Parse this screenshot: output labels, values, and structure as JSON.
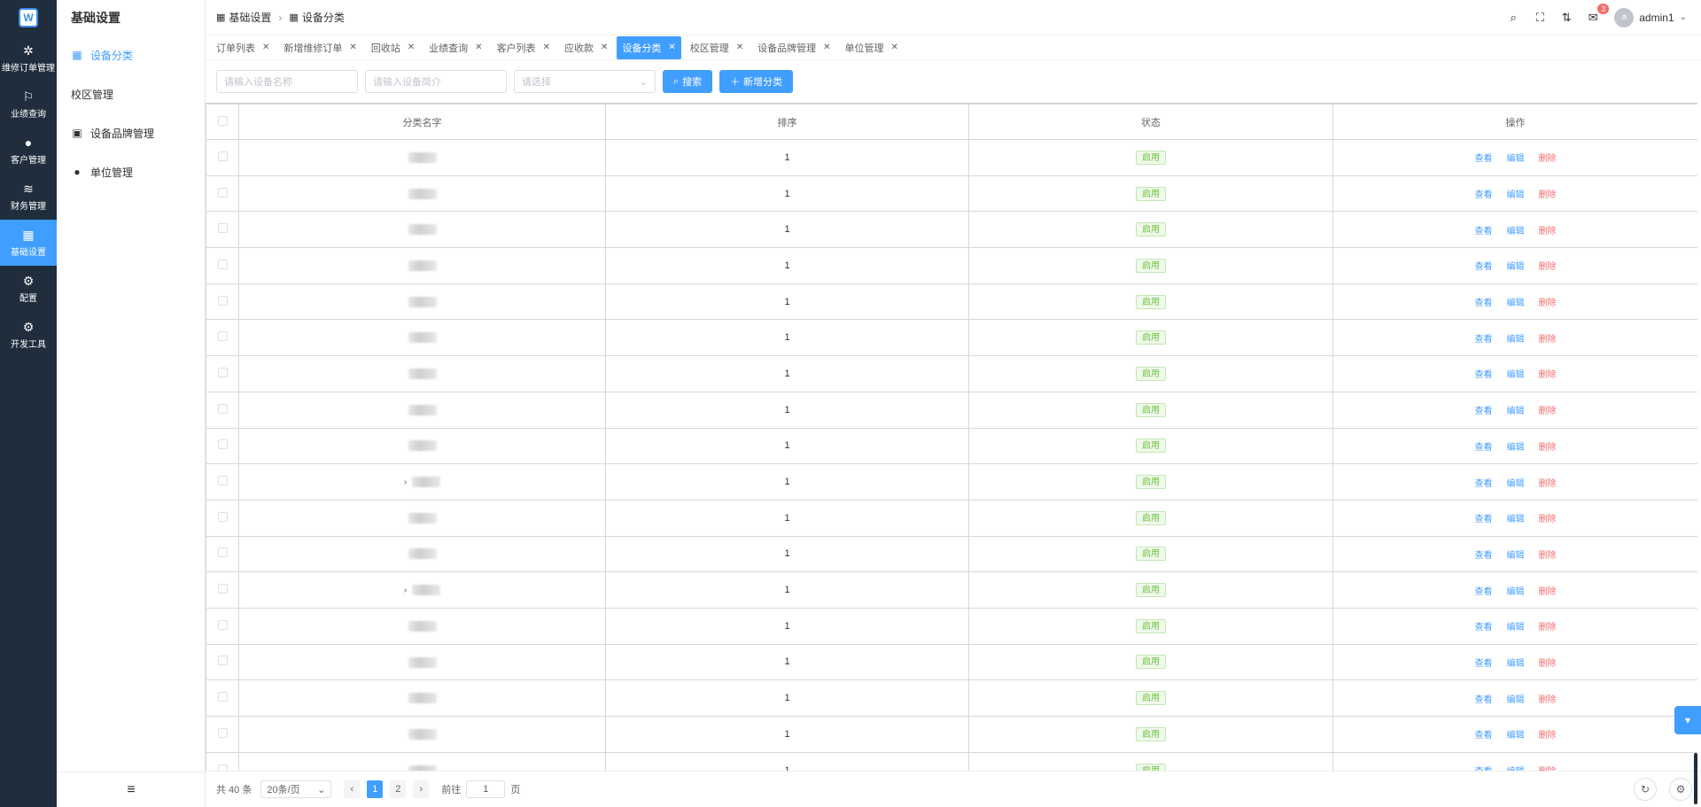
{
  "rail": {
    "logo_text": "W",
    "items": [
      {
        "label": "维修订单管理",
        "icon": "chip-icon",
        "glyph": "✲"
      },
      {
        "label": "业绩查询",
        "icon": "flag-board-icon",
        "glyph": "⚐"
      },
      {
        "label": "客户管理",
        "icon": "user-icon",
        "glyph": "●"
      },
      {
        "label": "财务管理",
        "icon": "database-icon",
        "glyph": "≋"
      },
      {
        "label": "基础设置",
        "icon": "grid-icon",
        "glyph": "▦"
      },
      {
        "label": "配置",
        "icon": "gear-icon",
        "glyph": "⚙"
      },
      {
        "label": "开发工具",
        "icon": "gear-icon",
        "glyph": "⚙"
      }
    ],
    "active_index": 4
  },
  "sub": {
    "title": "基础设置",
    "items": [
      {
        "label": "设备分类",
        "icon": "grid-icon",
        "glyph": "▦"
      },
      {
        "label": "校区管理",
        "icon": "",
        "glyph": ""
      },
      {
        "label": "设备品牌管理",
        "icon": "device-icon",
        "glyph": "▣"
      },
      {
        "label": "单位管理",
        "icon": "pin-icon",
        "glyph": "●"
      }
    ],
    "active_index": 0,
    "collapse_glyph": "≡"
  },
  "header": {
    "breadcrumb": [
      "基础设置",
      "设备分类"
    ],
    "badge": "3",
    "avatar": "a",
    "user": "admin1"
  },
  "tabs": [
    {
      "label": "订单列表"
    },
    {
      "label": "新增维修订单"
    },
    {
      "label": "回收站"
    },
    {
      "label": "业绩查询"
    },
    {
      "label": "客户列表"
    },
    {
      "label": "应收款"
    },
    {
      "label": "设备分类"
    },
    {
      "label": "校区管理"
    },
    {
      "label": "设备品牌管理"
    },
    {
      "label": "单位管理"
    }
  ],
  "active_tab": 6,
  "toolbar": {
    "name_placeholder": "请输入设备名称",
    "desc_placeholder": "请输入设备简介",
    "select_placeholder": "请选择",
    "search_label": "搜索",
    "add_label": "新增分类"
  },
  "table": {
    "headers": [
      "分类名字",
      "排序",
      "状态",
      "操作"
    ],
    "rows": [
      {
        "sort": "1",
        "status": "启用",
        "expand": false
      },
      {
        "sort": "1",
        "status": "启用",
        "expand": false
      },
      {
        "sort": "1",
        "status": "启用",
        "expand": false
      },
      {
        "sort": "1",
        "status": "启用",
        "expand": false
      },
      {
        "sort": "1",
        "status": "启用",
        "expand": false
      },
      {
        "sort": "1",
        "status": "启用",
        "expand": false
      },
      {
        "sort": "1",
        "status": "启用",
        "expand": false
      },
      {
        "sort": "1",
        "status": "启用",
        "expand": false
      },
      {
        "sort": "1",
        "status": "启用",
        "expand": false
      },
      {
        "sort": "1",
        "status": "启用",
        "expand": true
      },
      {
        "sort": "1",
        "status": "启用",
        "expand": false
      },
      {
        "sort": "1",
        "status": "启用",
        "expand": false
      },
      {
        "sort": "1",
        "status": "启用",
        "expand": true
      },
      {
        "sort": "1",
        "status": "启用",
        "expand": false
      },
      {
        "sort": "1",
        "status": "启用",
        "expand": false
      },
      {
        "sort": "1",
        "status": "启用",
        "expand": false
      },
      {
        "sort": "1",
        "status": "启用",
        "expand": false
      },
      {
        "sort": "1",
        "status": "启用",
        "expand": false
      }
    ],
    "ops": {
      "view": "查看",
      "edit": "编辑",
      "delete": "删除"
    }
  },
  "pagination": {
    "total": "共 40 条",
    "page_size": "20条/页",
    "pages": [
      "1",
      "2"
    ],
    "current": "1",
    "goto_label": "前往",
    "goto_value": "1",
    "page_unit": "页"
  }
}
